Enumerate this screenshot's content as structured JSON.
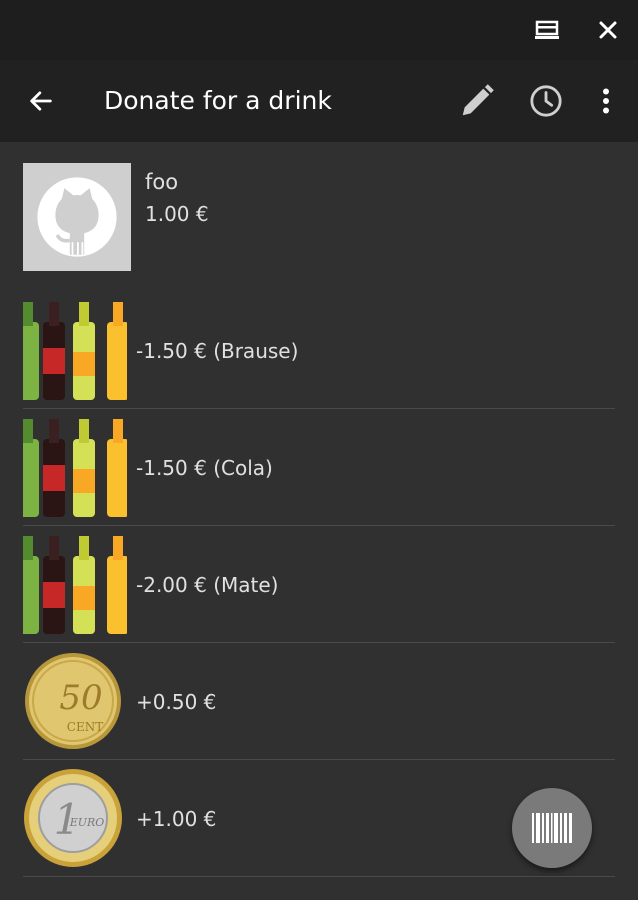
{
  "window": {
    "minimize_icon": "window-icon",
    "close_icon": "close-icon"
  },
  "appbar": {
    "title": "Donate for a drink",
    "back_icon": "arrow-back-icon",
    "edit_icon": "pencil-icon",
    "history_icon": "clock-icon",
    "menu_icon": "more-vert-icon"
  },
  "user": {
    "name": "foo",
    "balance": "1.00 €"
  },
  "items": [
    {
      "label": "-1.50 € (Brause)",
      "image": "bottles"
    },
    {
      "label": "-1.50 € (Cola)",
      "image": "bottles"
    },
    {
      "label": "-2.00 € (Mate)",
      "image": "bottles"
    },
    {
      "label": "+0.50 €",
      "image": "coin-50-cent"
    },
    {
      "label": "+1.00 €",
      "image": "coin-1-euro"
    }
  ],
  "fab": {
    "icon": "barcode-icon"
  },
  "colors": {
    "background": "#303030",
    "appbar": "#212121",
    "statusbar": "#1e1e1e",
    "fab": "#7a7a7a"
  }
}
